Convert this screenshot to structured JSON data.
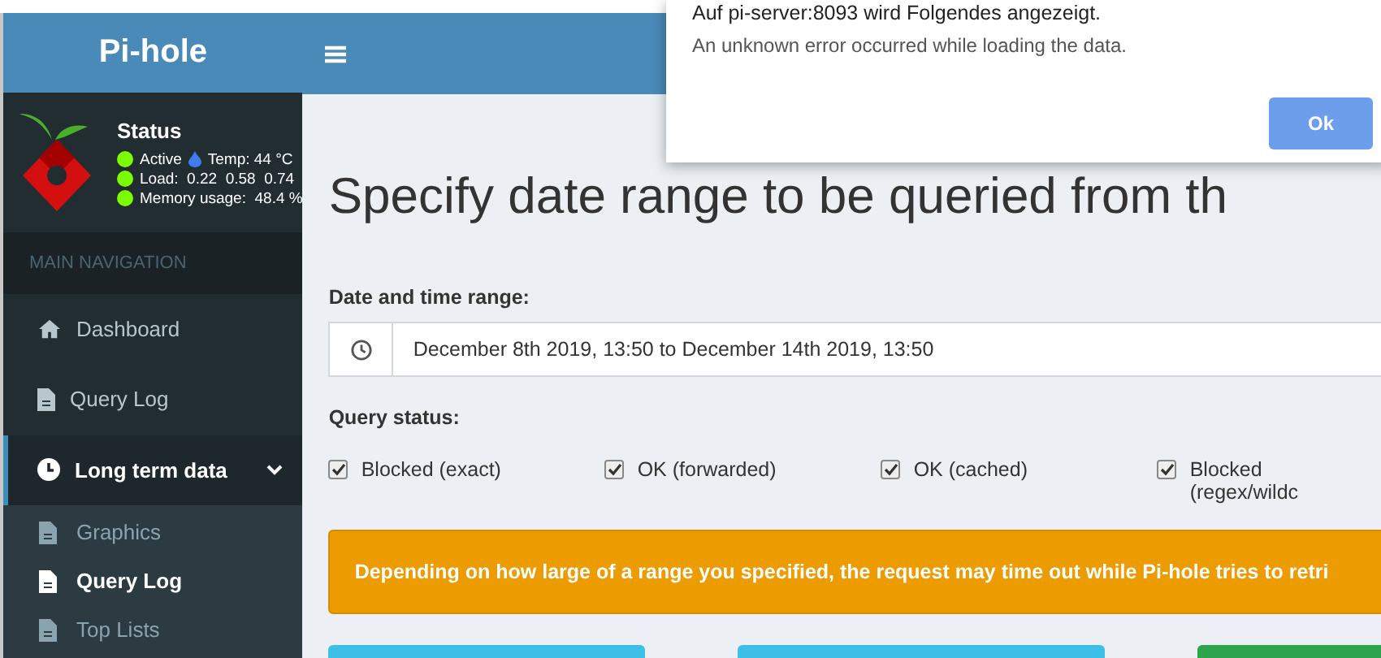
{
  "sidebar": {
    "logo_text": "Pi-hole",
    "status": {
      "title": "Status",
      "lines": [
        {
          "kind": "active",
          "text": "Active",
          "temp": "Temp: 44 °C"
        },
        {
          "kind": "plain",
          "text": "Load:  0.22  0.58  0.74"
        },
        {
          "kind": "plain",
          "text": "Memory usage:  48.4 %"
        }
      ]
    },
    "nav_header": "MAIN NAVIGATION",
    "items": [
      {
        "label": "Dashboard",
        "kind": "home",
        "selected": false
      },
      {
        "label": "Query Log",
        "kind": "file",
        "selected": false
      },
      {
        "label": "Long term data",
        "kind": "clock",
        "selected": true,
        "expanded": true,
        "children": [
          {
            "label": "Graphics",
            "selected": false
          },
          {
            "label": "Query Log",
            "selected": true
          },
          {
            "label": "Top Lists",
            "selected": false
          }
        ]
      }
    ]
  },
  "main": {
    "heading": "Specify date range to be queried from th",
    "date_label": "Date and time range:",
    "date_value": "December 8th 2019, 13:50 to December 14th 2019, 13:50",
    "status_label": "Query status:",
    "checkboxes": [
      {
        "label": "Blocked (exact)",
        "checked": true
      },
      {
        "label": "OK (forwarded)",
        "checked": true
      },
      {
        "label": "OK (cached)",
        "checked": true
      },
      {
        "label": "Blocked (regex/wildc",
        "checked": true
      }
    ],
    "alert": "Depending on how large of a range you specified, the request may time out while Pi-hole tries to retri",
    "action_buttons": [
      {
        "color": "#3dbfe8"
      },
      {
        "color": "#3dbfe8"
      },
      {
        "color": "#2ea44f"
      }
    ]
  },
  "dialog": {
    "title": "Auf pi-server:8093 wird Folgendes angezeigt.",
    "message": "An unknown error occurred while loading the data.",
    "button": "Ok"
  }
}
